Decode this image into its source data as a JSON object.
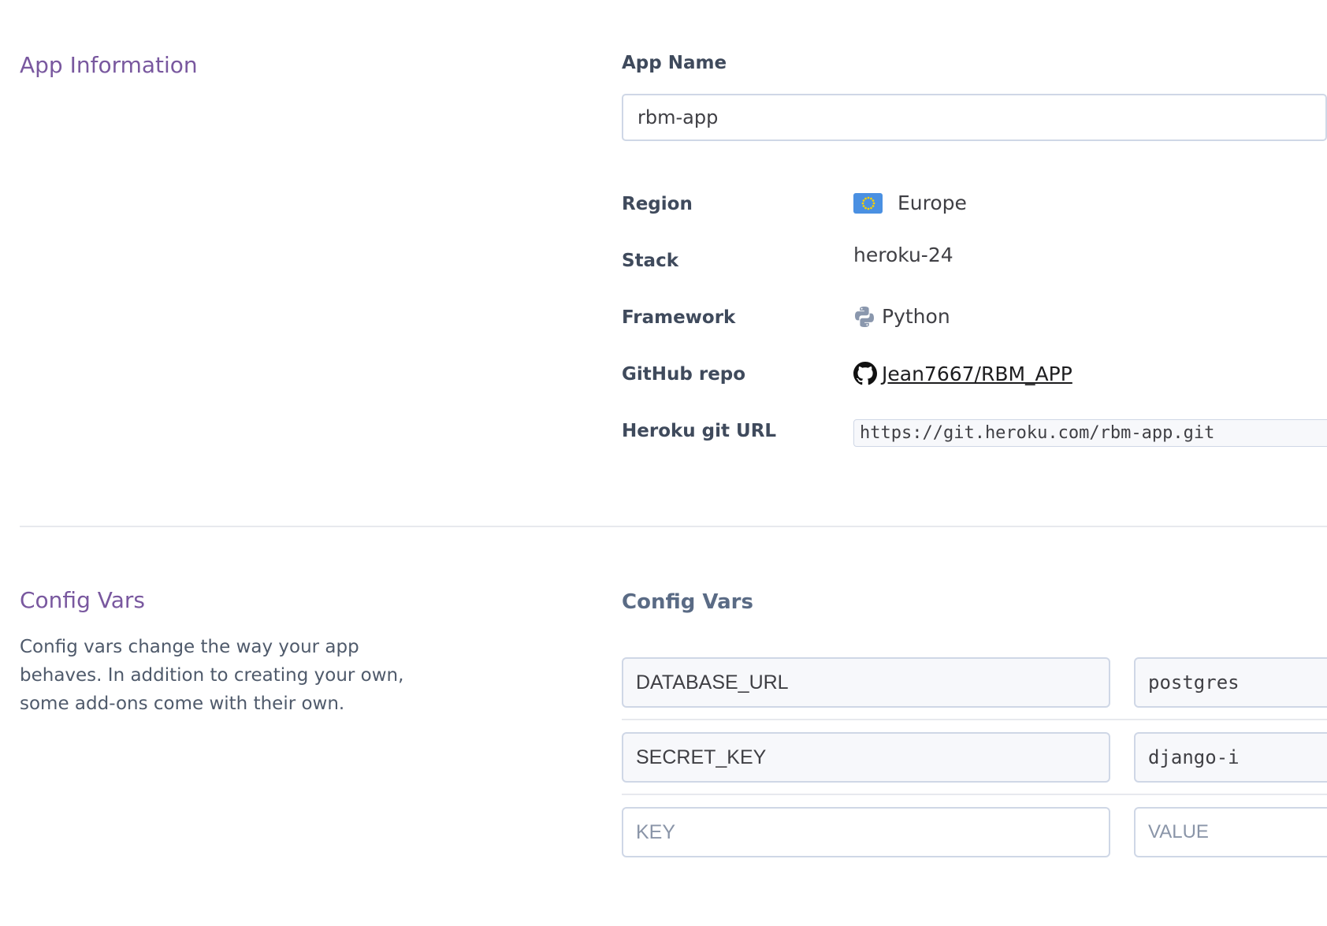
{
  "app_info": {
    "section_title": "App Information",
    "app_name_label": "App Name",
    "app_name_value": "rbm-app",
    "region_label": "Region",
    "region_value": "Europe",
    "region_icon": "eu-flag-icon",
    "stack_label": "Stack",
    "stack_value": "heroku-24",
    "framework_label": "Framework",
    "framework_value": "Python",
    "framework_icon": "python-icon",
    "github_label": "GitHub repo",
    "github_value": "Jean7667/RBM_APP",
    "github_icon": "github-icon",
    "git_url_label": "Heroku git URL",
    "git_url_value": "https://git.heroku.com/rbm-app.git"
  },
  "config_vars": {
    "section_title": "Config Vars",
    "description": "Config vars change the way your app behaves. In addition to creating your own, some add-ons come with their own.",
    "heading": "Config Vars",
    "rows": [
      {
        "key": "DATABASE_URL",
        "value": "postgres"
      },
      {
        "key": "SECRET_KEY",
        "value": "django-i"
      }
    ],
    "new_row": {
      "key_placeholder": "KEY",
      "value_placeholder": "VALUE"
    }
  },
  "colors": {
    "section_title": "#79589f",
    "label": "#3f4a5c",
    "input_border": "#cfd7e6",
    "flag_blue": "#4a90e2"
  }
}
